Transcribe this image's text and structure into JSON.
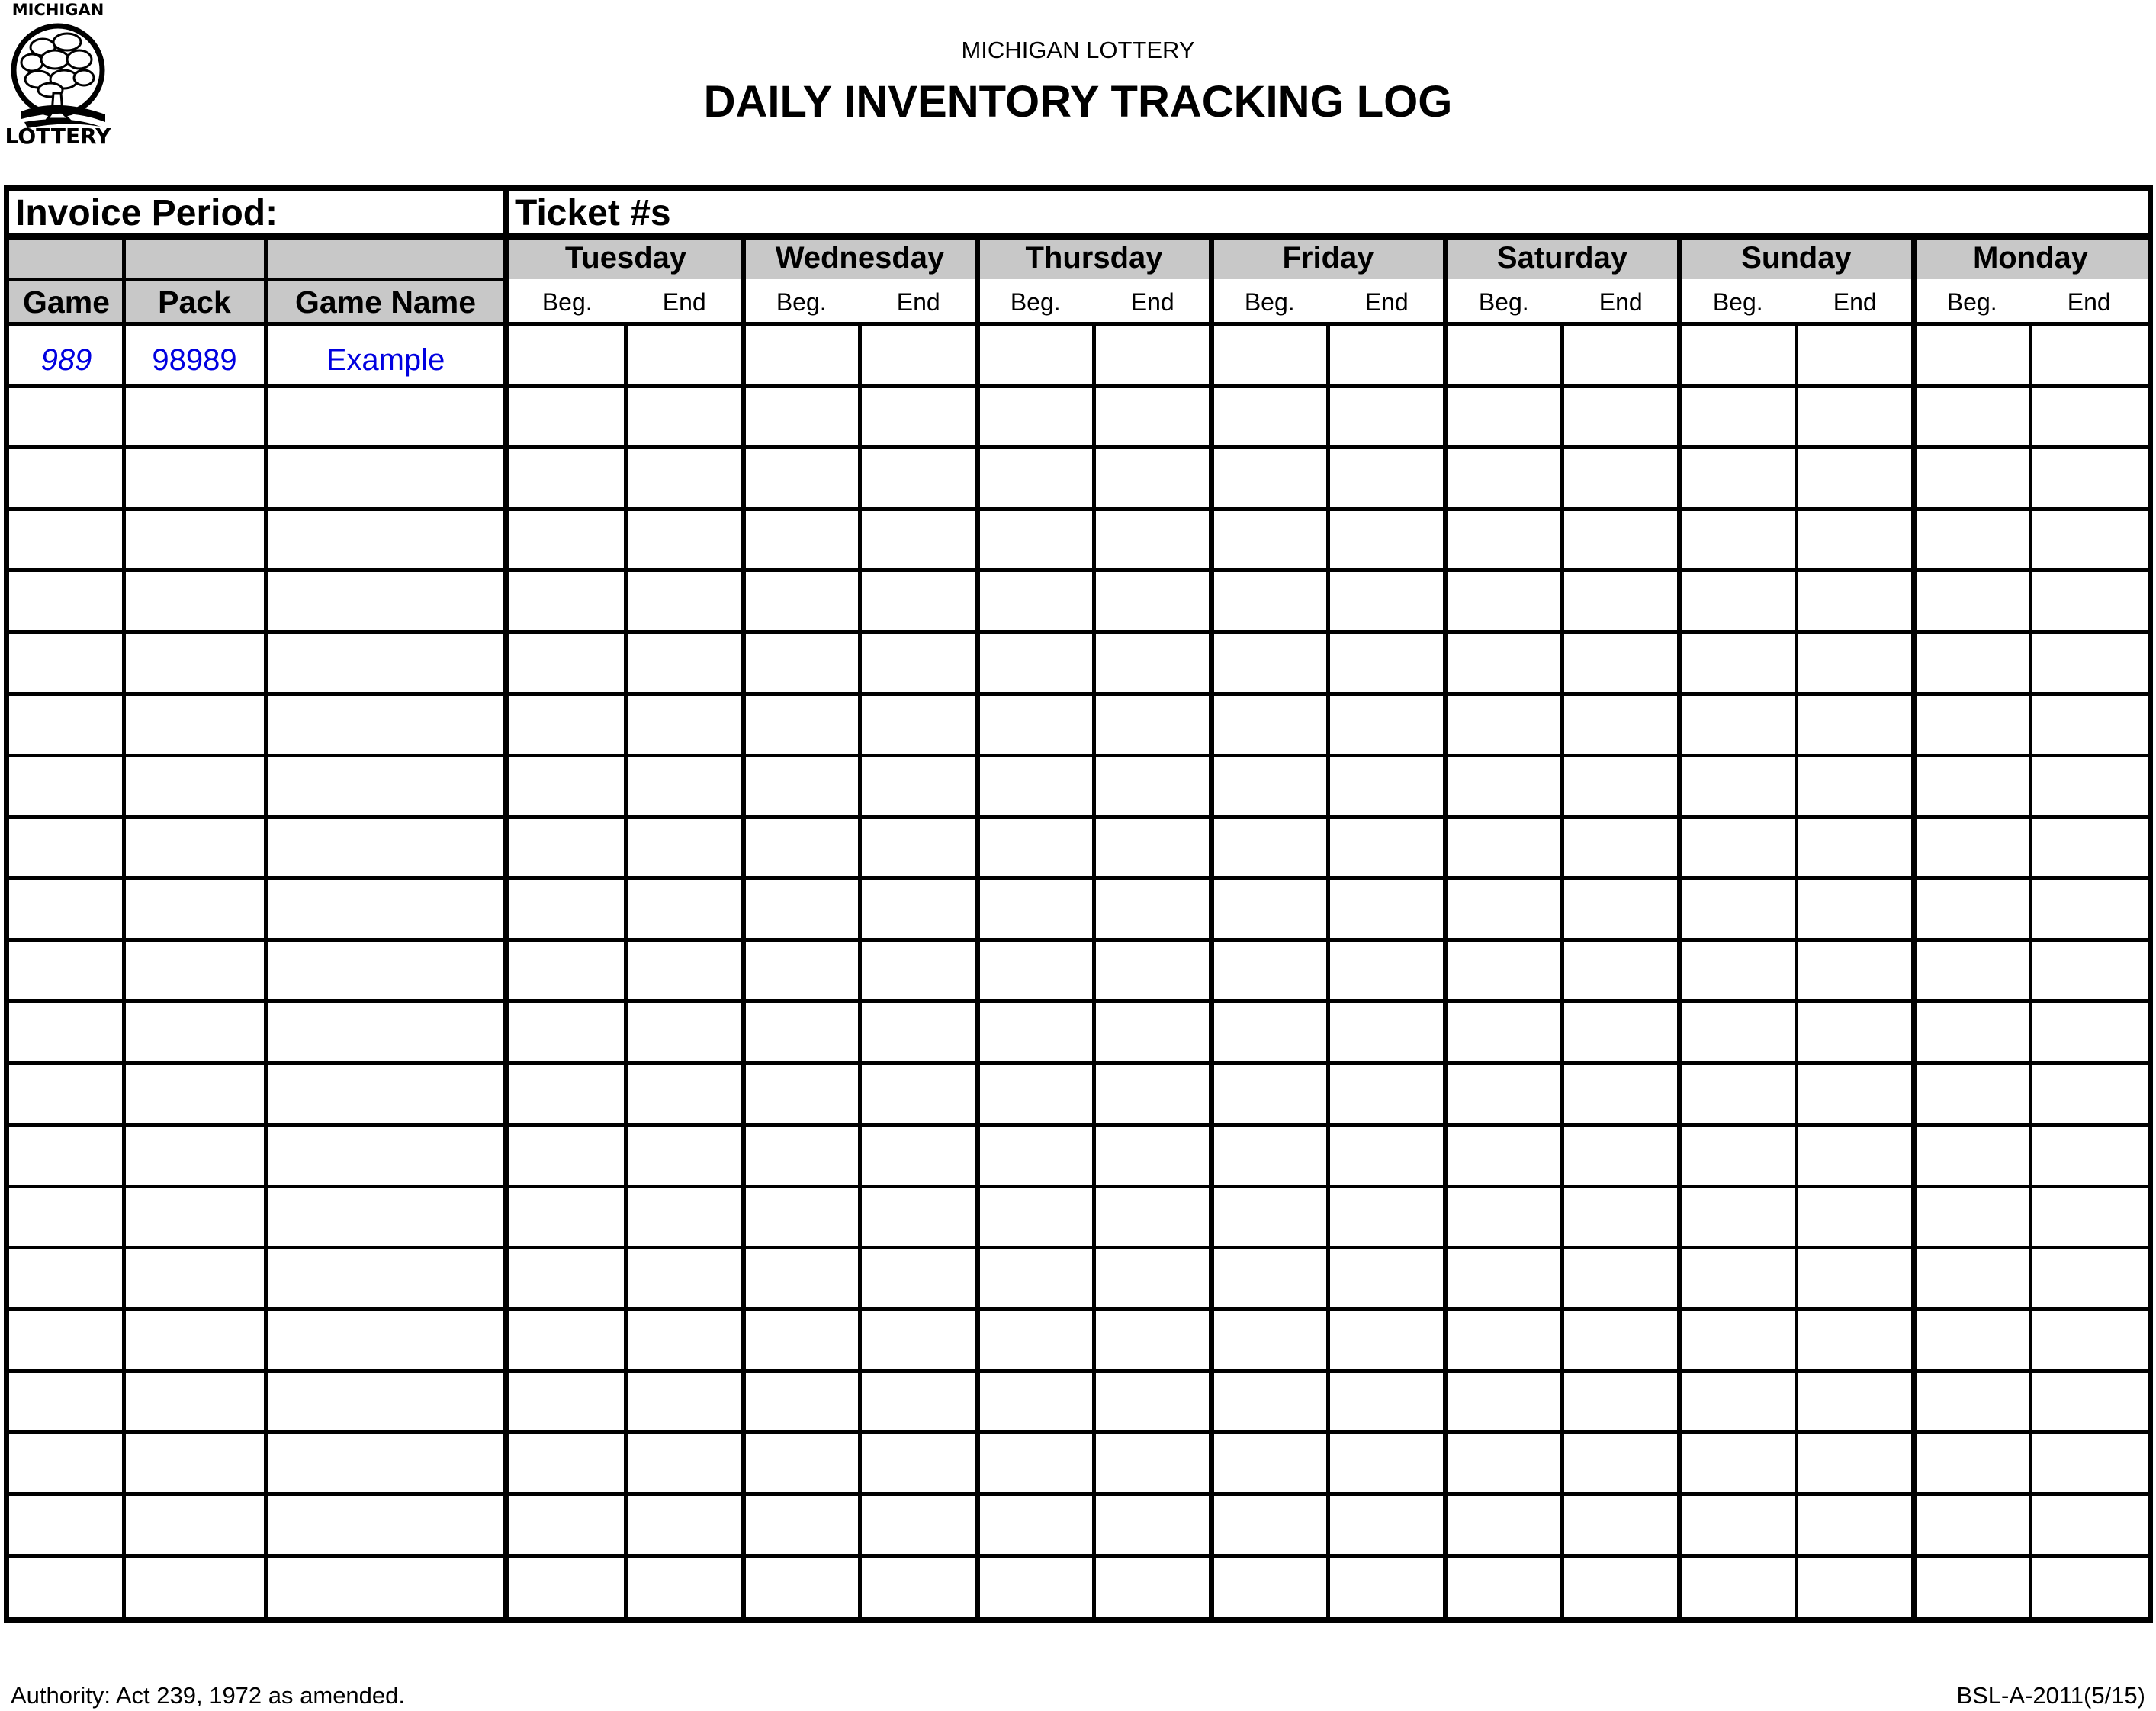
{
  "header": {
    "logo": {
      "top_text": "MICHIGAN",
      "bottom_text": "LOTTERY",
      "icon": "tree-logo-icon"
    },
    "organization": "MICHIGAN LOTTERY",
    "title": "DAILY INVENTORY TRACKING LOG"
  },
  "form": {
    "invoice_period_label": "Invoice Period:",
    "invoice_period_value": "",
    "ticket_numbers_label": "Ticket #s",
    "columns": {
      "game": "Game",
      "pack": "Pack",
      "game_name": "Game Name"
    },
    "days": [
      "Tuesday",
      "Wednesday",
      "Thursday",
      "Friday",
      "Saturday",
      "Sunday",
      "Monday"
    ],
    "sub_columns": {
      "beg": "Beg.",
      "end": "End"
    },
    "rows": [
      {
        "game": "989",
        "pack": "98989",
        "game_name": "Example",
        "tickets": [
          "",
          "",
          "",
          "",
          "",
          "",
          "",
          "",
          "",
          "",
          "",
          "",
          "",
          ""
        ]
      },
      {
        "game": "",
        "pack": "",
        "game_name": "",
        "tickets": []
      },
      {
        "game": "",
        "pack": "",
        "game_name": "",
        "tickets": []
      },
      {
        "game": "",
        "pack": "",
        "game_name": "",
        "tickets": []
      },
      {
        "game": "",
        "pack": "",
        "game_name": "",
        "tickets": []
      },
      {
        "game": "",
        "pack": "",
        "game_name": "",
        "tickets": []
      },
      {
        "game": "",
        "pack": "",
        "game_name": "",
        "tickets": []
      },
      {
        "game": "",
        "pack": "",
        "game_name": "",
        "tickets": []
      },
      {
        "game": "",
        "pack": "",
        "game_name": "",
        "tickets": []
      },
      {
        "game": "",
        "pack": "",
        "game_name": "",
        "tickets": []
      },
      {
        "game": "",
        "pack": "",
        "game_name": "",
        "tickets": []
      },
      {
        "game": "",
        "pack": "",
        "game_name": "",
        "tickets": []
      },
      {
        "game": "",
        "pack": "",
        "game_name": "",
        "tickets": []
      },
      {
        "game": "",
        "pack": "",
        "game_name": "",
        "tickets": []
      },
      {
        "game": "",
        "pack": "",
        "game_name": "",
        "tickets": []
      },
      {
        "game": "",
        "pack": "",
        "game_name": "",
        "tickets": []
      },
      {
        "game": "",
        "pack": "",
        "game_name": "",
        "tickets": []
      },
      {
        "game": "",
        "pack": "",
        "game_name": "",
        "tickets": []
      },
      {
        "game": "",
        "pack": "",
        "game_name": "",
        "tickets": []
      },
      {
        "game": "",
        "pack": "",
        "game_name": "",
        "tickets": []
      },
      {
        "game": "",
        "pack": "",
        "game_name": "",
        "tickets": []
      }
    ]
  },
  "colors": {
    "header_fill": "#c8c8c8",
    "example_text": "#0000e0",
    "rule": "#000000"
  },
  "footer": {
    "authority": "Authority: Act 239, 1972 as amended.",
    "form_code": "BSL-A-2011(5/15)"
  }
}
